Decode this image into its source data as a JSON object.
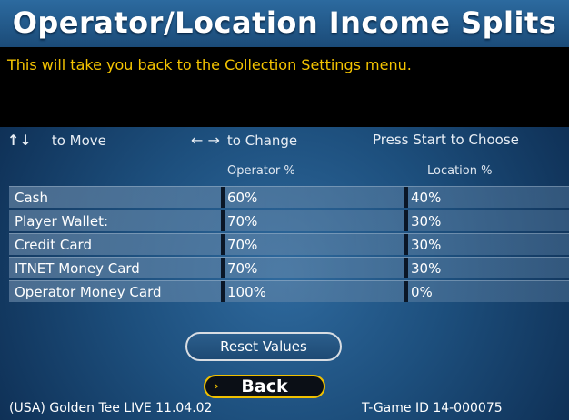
{
  "title": "Operator/Location Income Splits",
  "message": "This will take you back to the Collection Settings menu.",
  "help": {
    "move_arrows": "↑↓",
    "move_label": "to Move",
    "change_arrows": "← →",
    "change_label": "to Change",
    "start_label": "Press Start to Choose"
  },
  "columns": {
    "operator": "Operator %",
    "location": "Location %"
  },
  "rows": [
    {
      "label": "Cash",
      "operator": "60%",
      "location": "40%"
    },
    {
      "label": "Player Wallet:",
      "operator": "70%",
      "location": "30%"
    },
    {
      "label": "Credit Card",
      "operator": "70%",
      "location": "30%"
    },
    {
      "label": "ITNET Money Card",
      "operator": "70%",
      "location": "30%"
    },
    {
      "label": "Operator Money Card",
      "operator": "100%",
      "location": "0%"
    }
  ],
  "buttons": {
    "reset": "Reset Values",
    "back": "Back",
    "back_chevron": "›"
  },
  "footer": {
    "version": "(USA) Golden Tee LIVE 11.04.02",
    "game_id": "T-Game ID 14-000075"
  },
  "colors": {
    "message_text": "#f5c400",
    "back_border": "#f0c000"
  }
}
